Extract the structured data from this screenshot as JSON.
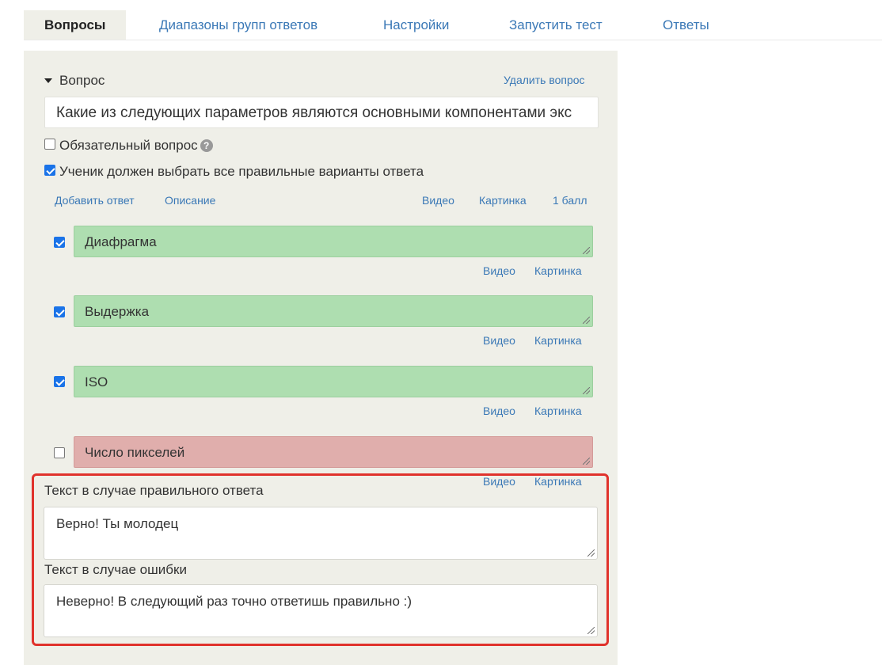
{
  "tabs": [
    {
      "label": "Вопросы",
      "active": true
    },
    {
      "label": "Диапазоны групп ответов"
    },
    {
      "label": "Настройки"
    },
    {
      "label": "Запустить тест"
    },
    {
      "label": "Ответы"
    }
  ],
  "question": {
    "header": "Вопрос",
    "delete_label": "Удалить вопрос",
    "text": "Какие из следующих параметров являются основными компонентами экс",
    "required_label": "Обязательный вопрос",
    "required_checked": false,
    "all_correct_label": "Ученик должен выбрать все правильные варианты ответа",
    "all_correct_checked": true
  },
  "toolbar": {
    "add_answer": "Добавить ответ",
    "description": "Описание",
    "video": "Видео",
    "picture": "Картинка",
    "points": "1 балл"
  },
  "answers": [
    {
      "text": "Диафрагма",
      "checked": true,
      "video": "Видео",
      "picture": "Картинка"
    },
    {
      "text": "Выдержка",
      "checked": true,
      "video": "Видео",
      "picture": "Картинка"
    },
    {
      "text": "ISO",
      "checked": true,
      "video": "Видео",
      "picture": "Картинка"
    },
    {
      "text": "Число пикселей",
      "checked": false,
      "video": "Видео",
      "picture": "Картинка"
    }
  ],
  "feedback": {
    "correct_label": "Текст в случае правильного ответа",
    "correct_text": "Верно! Ты молодец",
    "error_label": "Текст в случае ошибки",
    "error_text": "Неверно! В следующий раз точно ответишь правильно :)"
  },
  "colors": {
    "link": "#3a78b6",
    "correct_answer_bg": "#aedeb0",
    "wrong_answer_bg": "#e0aeac",
    "highlight": "#e0322c",
    "panel_bg": "#efefe8"
  }
}
